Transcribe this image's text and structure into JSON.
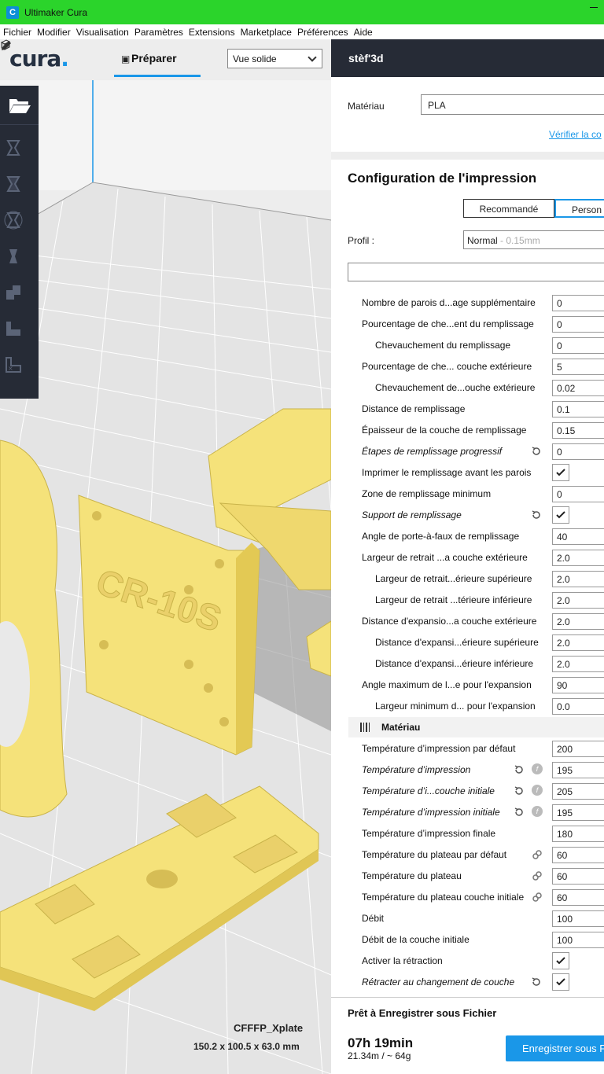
{
  "window": {
    "title": "Ultimaker Cura",
    "icon": "cura-app-icon"
  },
  "menu": [
    "Fichier",
    "Modifier",
    "Visualisation",
    "Paramètres",
    "Extensions",
    "Marketplace",
    "Préférences",
    "Aide"
  ],
  "stage": {
    "tab_label": "Préparer",
    "view_mode": "Vue solide"
  },
  "object": {
    "name": "CFFFP_Xplate",
    "dimensions": "150.2 x 100.5 x 63.0 mm"
  },
  "printer": {
    "name": "stèf'3d"
  },
  "material": {
    "label": "Matériau",
    "value": "PLA",
    "verify_link": "Vérifier la co"
  },
  "print_setup": {
    "title": "Configuration de l'impression",
    "mode_recommended": "Recommandé",
    "mode_custom": "Person",
    "profile_label": "Profil :",
    "profile_value": "Normal",
    "profile_layer": " - 0.15mm",
    "search_placeholder": ""
  },
  "settings": [
    {
      "label": "Nombre de parois d...age supplémentaire",
      "value": "0"
    },
    {
      "label": "Pourcentage de che...ent du remplissage",
      "value": "0"
    },
    {
      "label": "Chevauchement du remplissage",
      "value": "0"
    },
    {
      "label": "Pourcentage de che... couche extérieure",
      "value": "5"
    },
    {
      "label": "Chevauchement de...ouche extérieure",
      "value": "0.02"
    },
    {
      "label": "Distance de remplissage",
      "value": "0.1"
    },
    {
      "label": "Épaisseur de la couche de remplissage",
      "value": "0.15"
    },
    {
      "label": "Étapes de remplissage progressif",
      "value": "0"
    },
    {
      "label": "Imprimer le remplissage avant les parois",
      "value": ""
    },
    {
      "label": "Zone de remplissage minimum",
      "value": "0"
    },
    {
      "label": "Support de remplissage",
      "value": ""
    },
    {
      "label": "Angle de porte-à-faux de remplissage",
      "value": "40"
    },
    {
      "label": "Largeur de retrait ...a couche extérieure",
      "value": "2.0"
    },
    {
      "label": "Largeur de retrait...érieure supérieure",
      "value": "2.0"
    },
    {
      "label": "Largeur de retrait ...térieure inférieure",
      "value": "2.0"
    },
    {
      "label": "Distance d'expansio...a couche extérieure",
      "value": "2.0"
    },
    {
      "label": "Distance d'expansi...érieure supérieure",
      "value": "2.0"
    },
    {
      "label": "Distance d'expansi...érieure inférieure",
      "value": "2.0"
    },
    {
      "label": "Angle maximum de l...e pour l'expansion",
      "value": "90"
    },
    {
      "label": "Largeur minimum d... pour l'expansion",
      "value": "0.0"
    }
  ],
  "material_category": {
    "label": "Matériau"
  },
  "material_settings": [
    {
      "label": "Température d’impression par défaut",
      "value": "200"
    },
    {
      "label": "Température d’impression",
      "value": "195"
    },
    {
      "label": "Température d’i...couche initiale",
      "value": "205"
    },
    {
      "label": "Température d’impression initiale",
      "value": "195"
    },
    {
      "label": "Température d’impression finale",
      "value": "180"
    },
    {
      "label": "Température du plateau par défaut",
      "value": "60"
    },
    {
      "label": "Température du plateau",
      "value": "60"
    },
    {
      "label": "Température du plateau couche initiale",
      "value": "60"
    },
    {
      "label": "Débit",
      "value": "100"
    },
    {
      "label": "Débit de la couche initiale",
      "value": "100"
    },
    {
      "label": "Activer la rétraction",
      "value": ""
    },
    {
      "label": "Rétracter au changement de couche",
      "value": ""
    }
  ],
  "footer": {
    "ready": "Prêt à Enregistrer sous Fichier",
    "time": "07h 19min",
    "usage": "21.34m / ~ 64g",
    "save_button": "Enregistrer sous F"
  },
  "colors": {
    "accent": "#1a97e8",
    "titlebar": "#2bd42b",
    "dark": "#262b36",
    "model": "#f5e27a"
  }
}
